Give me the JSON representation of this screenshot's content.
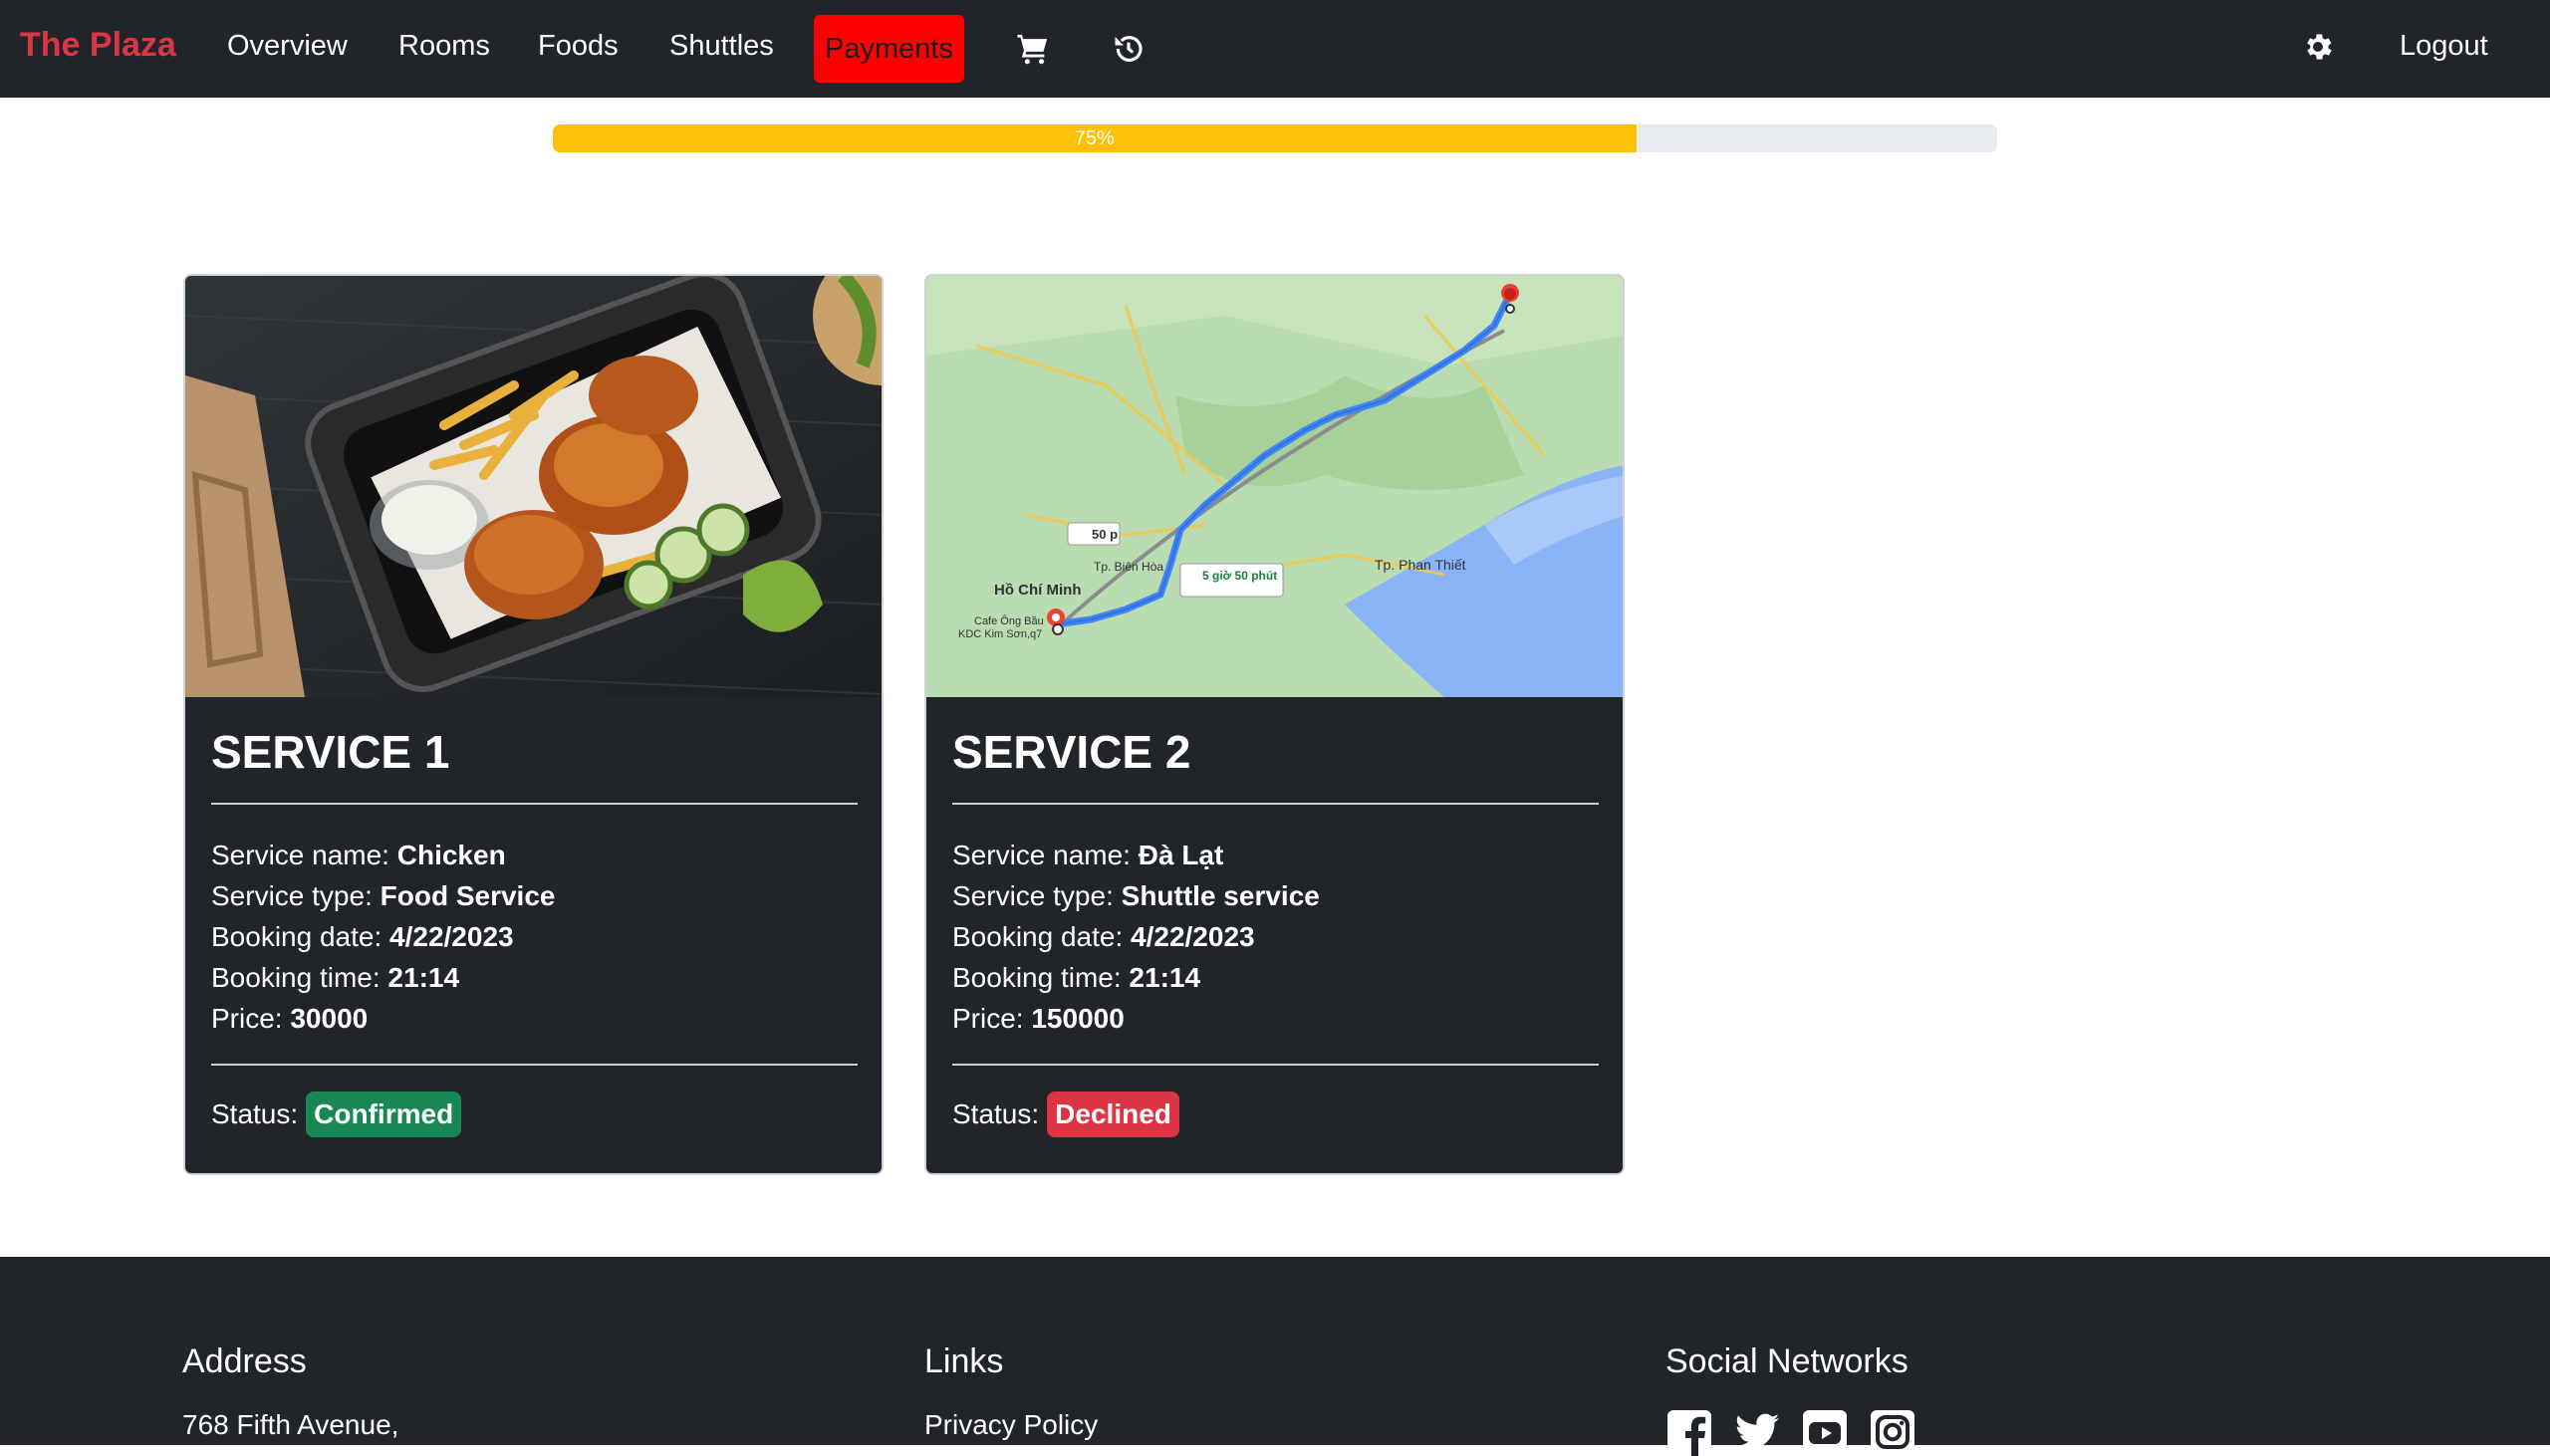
{
  "navbar": {
    "brand": "The Plaza",
    "items": [
      "Overview",
      "Rooms",
      "Foods",
      "Shuttles"
    ],
    "active": "Payments",
    "active_color": "#ff0000",
    "icons": [
      "cart-icon",
      "history-icon",
      "gear-icon"
    ],
    "logout": "Logout"
  },
  "progress": {
    "value": 0.75,
    "label": "75%",
    "color": "#ffc107"
  },
  "services": [
    {
      "title": "SERVICE 1",
      "image": "fried-chicken-photo",
      "labels": {
        "name": "Service name: ",
        "type": "Service type: ",
        "date": "Booking date: ",
        "time": "Booking time: ",
        "price": "Price: ",
        "status": "Status:"
      },
      "name": "Chicken",
      "type": "Food Service",
      "date": "4/22/2023",
      "time": "21:14",
      "price": "30000",
      "status": "Confirmed",
      "status_color": "#198754"
    },
    {
      "title": "SERVICE 2",
      "image": "route-map",
      "map_labels": {
        "origin": "Hồ Chí Minh",
        "dest_area": "Tp. Phan Thiết",
        "flight": "50 p",
        "drive": "5 giờ 50 phút",
        "town": "Tp. Biên Hòa",
        "stop1": "Cafe Ông Bầu",
        "stop2": "KDC Kim Sơn,q7"
      },
      "labels": {
        "name": "Service name: ",
        "type": "Service type: ",
        "date": "Booking date: ",
        "time": "Booking time: ",
        "price": "Price: ",
        "status": "Status:"
      },
      "name": "Đà Lạt",
      "type": "Shuttle service",
      "date": "4/22/2023",
      "time": "21:14",
      "price": "150000",
      "status": "Declined",
      "status_color": "#dc3545"
    }
  ],
  "footer": {
    "address_title": "Address",
    "address_line": "768 Fifth Avenue,",
    "links_title": "Links",
    "links_first": "Privacy Policy",
    "social_title": "Social Networks",
    "social_icons": [
      "facebook-icon",
      "twitter-icon",
      "youtube-icon",
      "instagram-icon"
    ]
  }
}
